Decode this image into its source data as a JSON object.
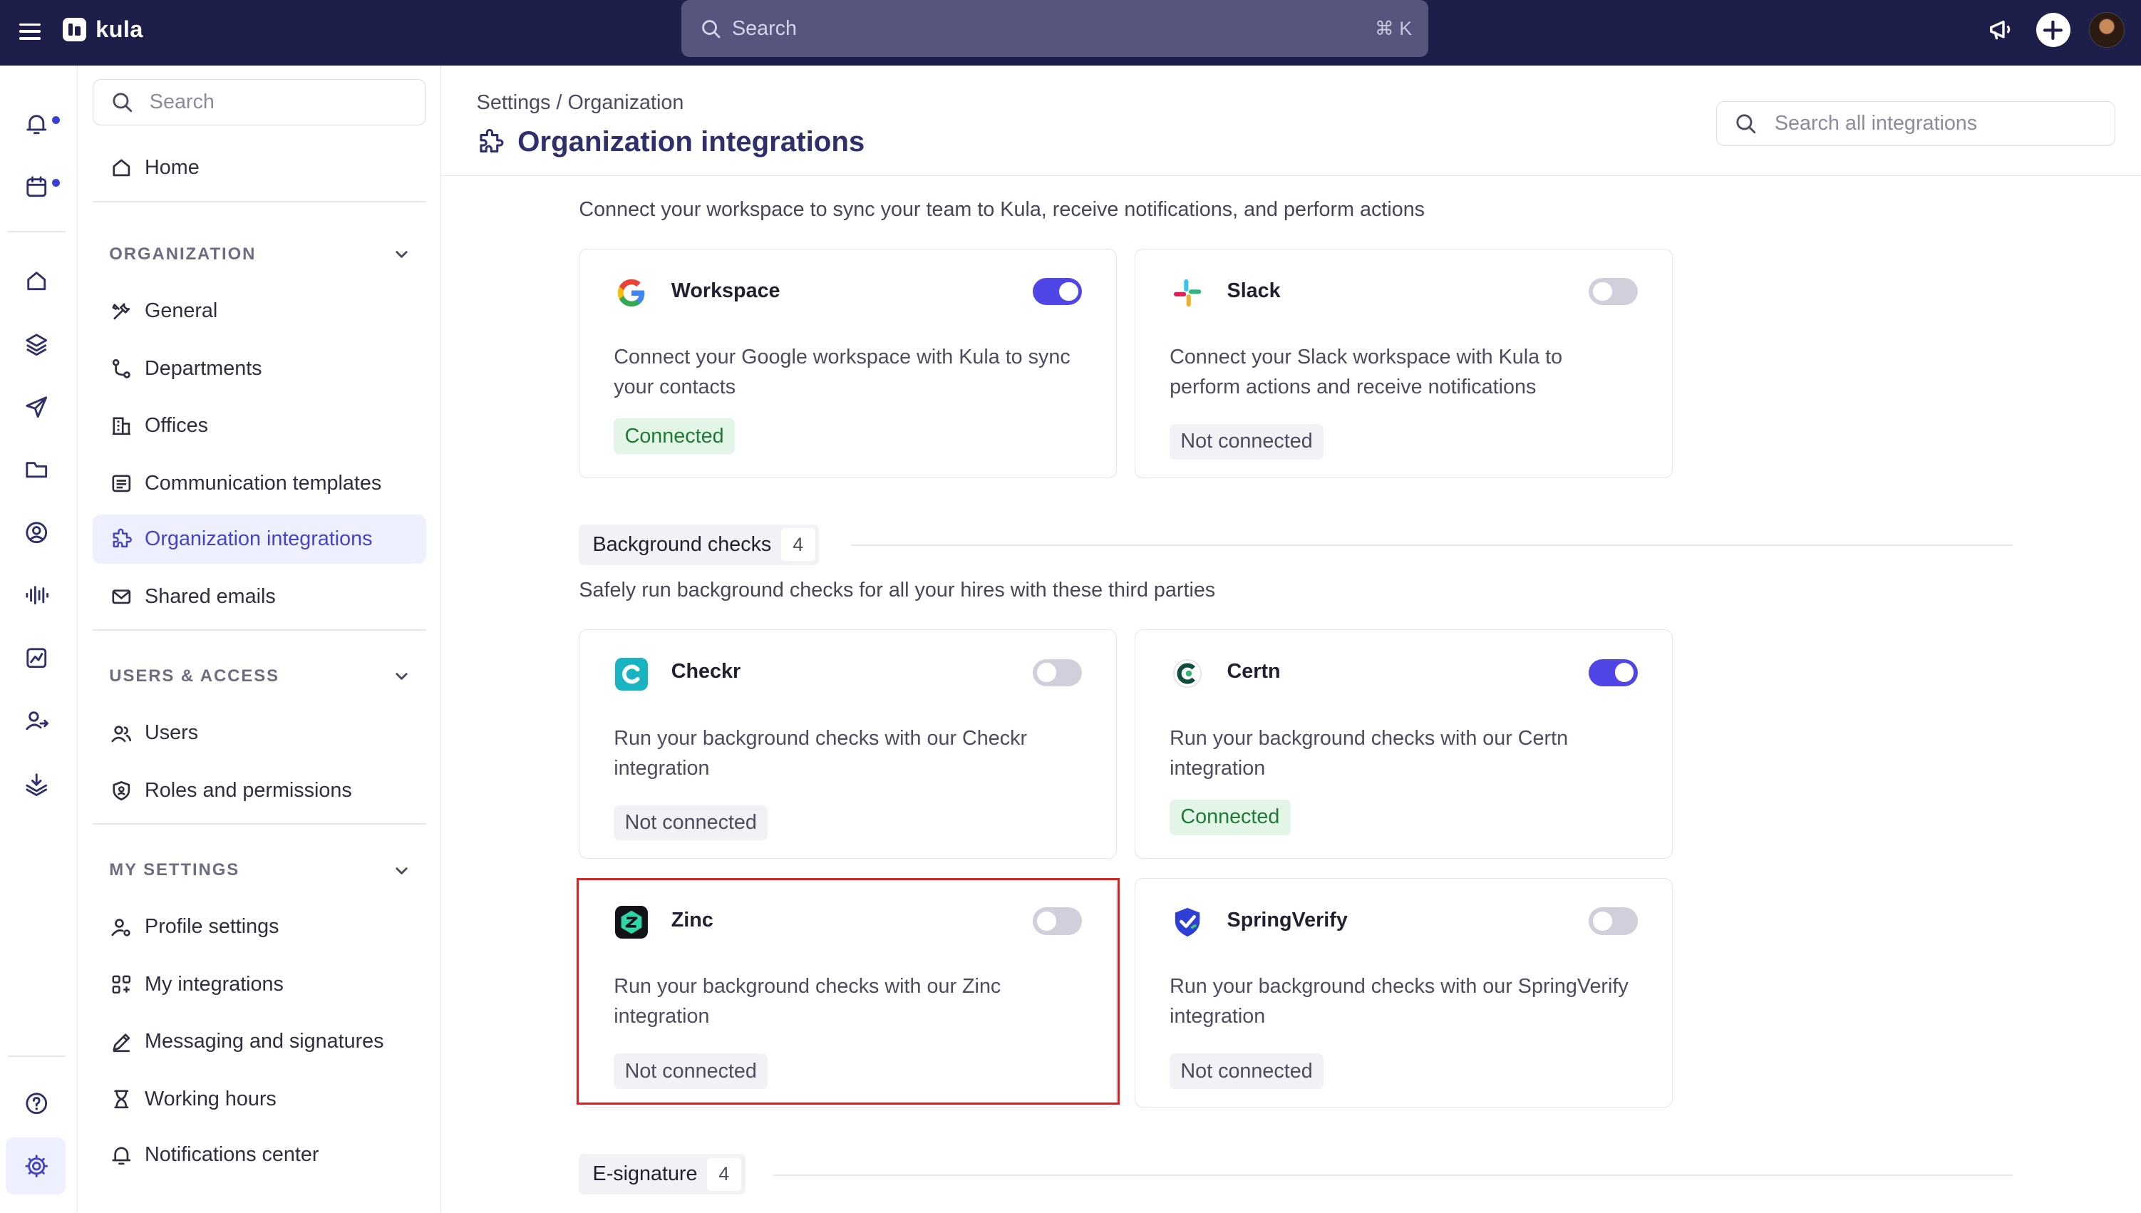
{
  "app": {
    "name": "kula"
  },
  "topbar": {
    "search_placeholder": "Search",
    "shortcut": "⌘ K"
  },
  "sidebar": {
    "search_placeholder": "Search",
    "home": "Home",
    "sections": [
      {
        "title": "ORGANIZATION",
        "items": [
          "General",
          "Departments",
          "Offices",
          "Communication templates",
          "Organization integrations",
          "Shared emails"
        ]
      },
      {
        "title": "USERS & ACCESS",
        "items": [
          "Users",
          "Roles and permissions"
        ]
      },
      {
        "title": "MY SETTINGS",
        "items": [
          "Profile settings",
          "My integrations",
          "Messaging and signatures",
          "Working hours",
          "Notifications center"
        ]
      }
    ],
    "active_item": "Organization integrations"
  },
  "header": {
    "breadcrumb": "Settings / Organization",
    "title": "Organization integrations",
    "search_placeholder": "Search all integrations"
  },
  "groups": {
    "workspace": {
      "description": "Connect your workspace to sync your team to Kula, receive notifications, and perform actions",
      "cards": [
        {
          "name": "Workspace",
          "description": "Connect your Google workspace with Kula to sync your contacts",
          "enabled": true,
          "status": "Connected"
        },
        {
          "name": "Slack",
          "description": "Connect your Slack workspace with Kula to perform actions and receive notifications",
          "enabled": false,
          "status": "Not connected"
        }
      ]
    },
    "background_checks": {
      "title": "Background checks",
      "count": "4",
      "description": "Safely run background checks for all your hires with these third parties",
      "cards": [
        {
          "name": "Checkr",
          "description": "Run your background checks with our Checkr integration",
          "enabled": false,
          "status": "Not connected"
        },
        {
          "name": "Certn",
          "description": "Run your background checks with our Certn integration",
          "enabled": true,
          "status": "Connected"
        },
        {
          "name": "Zinc",
          "description": "Run your background checks with our Zinc integration",
          "enabled": false,
          "status": "Not connected"
        },
        {
          "name": "SpringVerify",
          "description": "Run your background checks with our SpringVerify integration",
          "enabled": false,
          "status": "Not connected"
        }
      ]
    },
    "e_signature": {
      "title": "E-signature",
      "count": "4"
    }
  },
  "colors": {
    "nav_bg": "#1e1e4b",
    "accent": "#4f46e5",
    "connected": "#1f7a34",
    "highlight": "#e02020"
  }
}
